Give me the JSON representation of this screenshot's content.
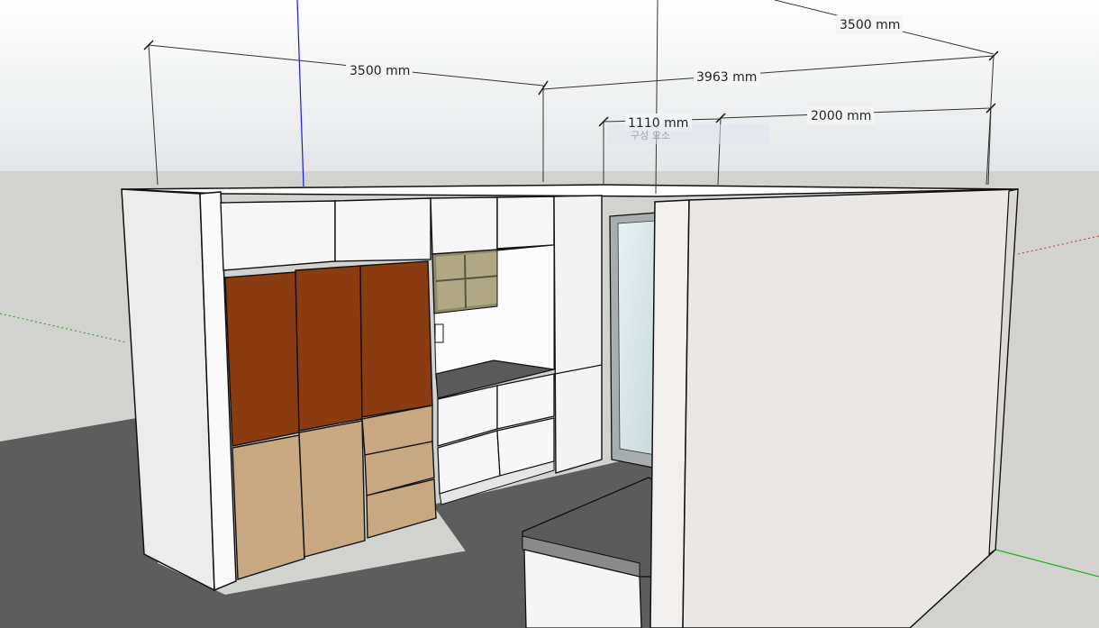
{
  "viewport": {
    "sky_color": "#eceeef",
    "ground_color": "#d2d2ce",
    "floor_color": "#5c5c5d"
  },
  "axes": {
    "blue_axis_icon": "blue-axis-line",
    "red_axis_icon": "red-axis-line",
    "green_axis_icon": "green-axis-line"
  },
  "dimensions": {
    "top_right": "3500 mm",
    "left": "3500 mm",
    "middle": "3963 mm",
    "small": "1110 mm",
    "right": "2000 mm"
  },
  "tooltip": {
    "text": "구성 요소"
  },
  "colors": {
    "upper_cabinet": "#8a3c10",
    "lower_cabinet": "#c8a880",
    "countertop": "#5a5a5a",
    "wall": "#ebe8e6",
    "cabinet_white": "#f4f4f4"
  }
}
